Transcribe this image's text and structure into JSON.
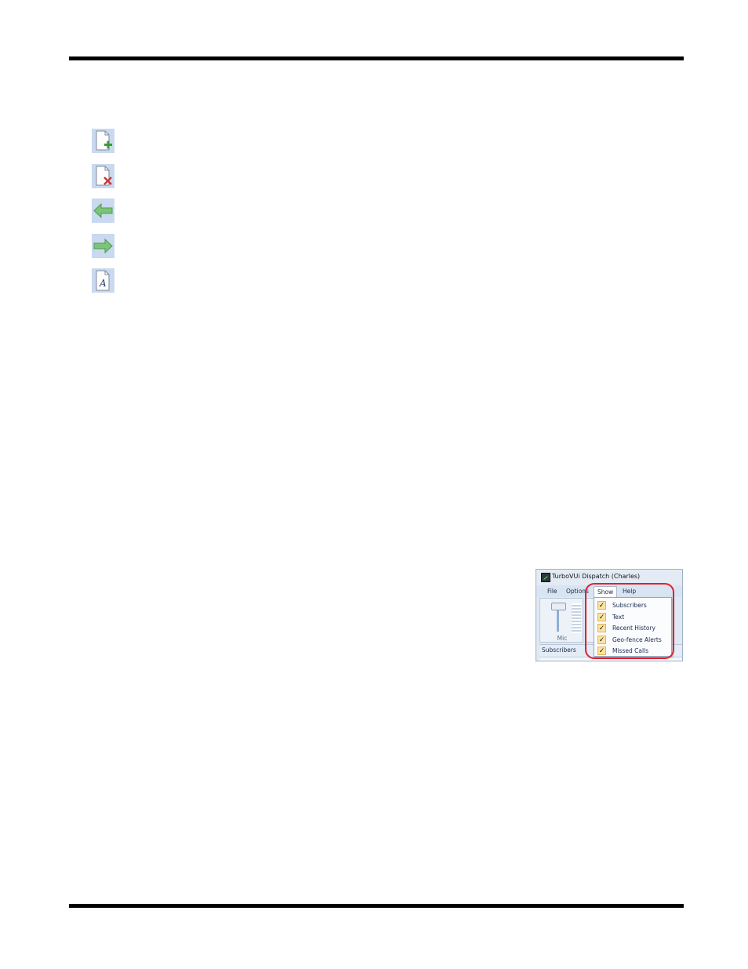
{
  "colors": {
    "rule": "#000000",
    "highlight": "#e0202b",
    "icon_tile": "#c9d9ef",
    "arrow_green": "#7cc47a",
    "check_fill": "#fde3a0"
  },
  "icons": [
    {
      "name": "add-document-icon"
    },
    {
      "name": "delete-document-icon"
    },
    {
      "name": "back-arrow-icon"
    },
    {
      "name": "forward-arrow-icon"
    },
    {
      "name": "text-document-icon"
    }
  ],
  "screenshot": {
    "title": "TurboVUi Dispatch  (Charles)",
    "menu": {
      "file": "File",
      "options": "Options",
      "show": "Show",
      "help": "Help"
    },
    "mic_label": "Mic",
    "tab_label": "Subscribers",
    "dropdown": [
      {
        "label": "Subscribers",
        "checked": true
      },
      {
        "label": "Text",
        "checked": true
      },
      {
        "label": "Recent History",
        "checked": true
      },
      {
        "label": "Geo-fence Alerts",
        "checked": true
      },
      {
        "label": "Missed Calls",
        "checked": true
      }
    ],
    "check_mark": "✓"
  }
}
